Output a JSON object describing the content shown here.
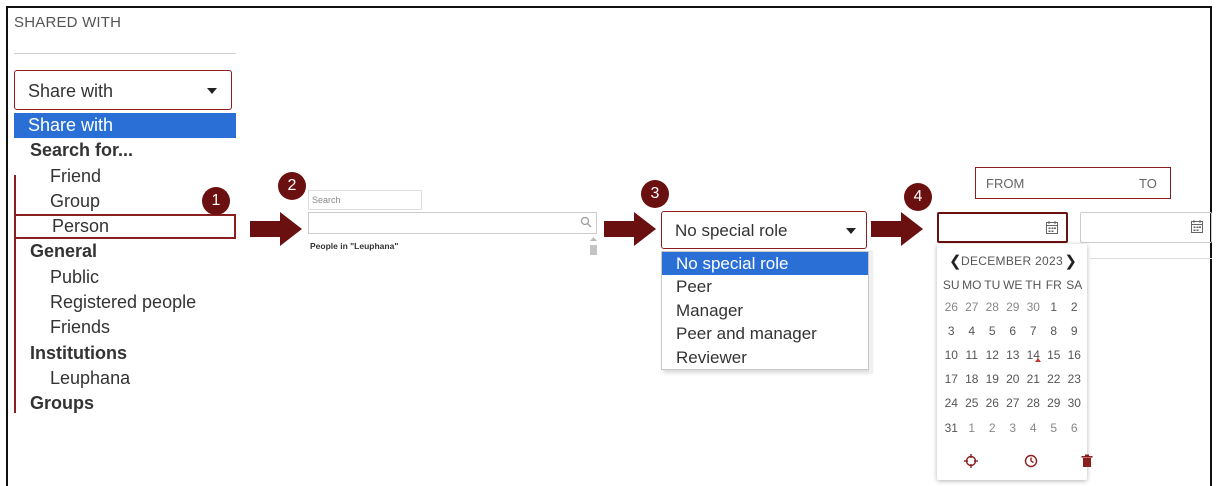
{
  "panel1": {
    "title": "SHARED WITH",
    "select_value": "Share with",
    "options": [
      {
        "label": "Share with",
        "kind": "selected"
      },
      {
        "label": "Search for...",
        "kind": "group"
      },
      {
        "label": "Friend",
        "kind": "child"
      },
      {
        "label": "Group",
        "kind": "child"
      },
      {
        "label": "Person",
        "kind": "child-highlight"
      },
      {
        "label": "General",
        "kind": "group"
      },
      {
        "label": "Public",
        "kind": "child"
      },
      {
        "label": "Registered people",
        "kind": "child"
      },
      {
        "label": "Friends",
        "kind": "child"
      },
      {
        "label": "Institutions",
        "kind": "group"
      },
      {
        "label": "Leuphana",
        "kind": "child"
      },
      {
        "label": "Groups",
        "kind": "group"
      }
    ]
  },
  "steps": [
    "1",
    "2",
    "3",
    "4"
  ],
  "panel2": {
    "search_placeholder": "Search",
    "people_label": "People in \"Leuphana\""
  },
  "panel3": {
    "select_value": "No special role",
    "options": [
      "No special role",
      "Peer",
      "Manager",
      "Peer and manager",
      "Reviewer"
    ]
  },
  "panel4": {
    "from_label": "FROM",
    "to_label": "TO",
    "calendar": {
      "month": "DECEMBER 2023",
      "weekdays": [
        "SU",
        "MO",
        "TU",
        "WE",
        "TH",
        "FR",
        "SA"
      ],
      "weeks": [
        [
          "26",
          "27",
          "28",
          "29",
          "30",
          "1",
          "2"
        ],
        [
          "3",
          "4",
          "5",
          "6",
          "7",
          "8",
          "9"
        ],
        [
          "10",
          "11",
          "12",
          "13",
          "14",
          "15",
          "16"
        ],
        [
          "17",
          "18",
          "19",
          "20",
          "21",
          "22",
          "23"
        ],
        [
          "24",
          "25",
          "26",
          "27",
          "28",
          "29",
          "30"
        ],
        [
          "31",
          "1",
          "2",
          "3",
          "4",
          "5",
          "6"
        ]
      ],
      "muted_leading": 5,
      "muted_trailing": 6,
      "today": "14"
    }
  },
  "colors": {
    "accent": "#8b1f1f",
    "badge": "#6b1010",
    "selected": "#2a6fd6"
  }
}
